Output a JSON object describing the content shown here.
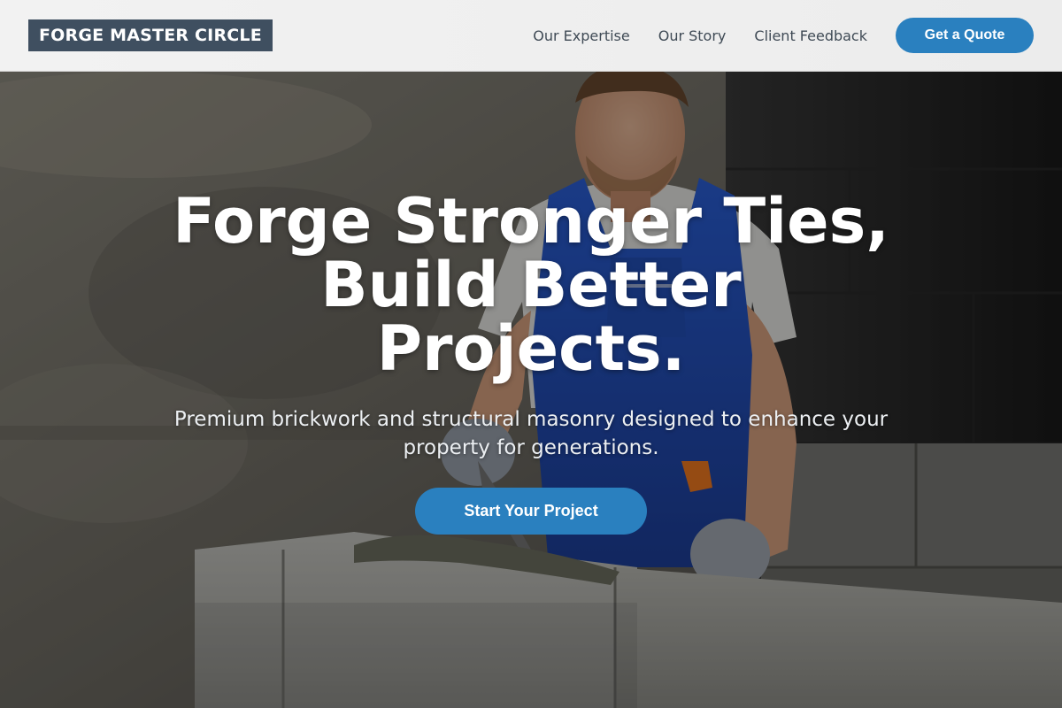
{
  "header": {
    "logo": "FORGE MASTER CIRCLE",
    "nav": [
      {
        "label": "Our Expertise"
      },
      {
        "label": "Our Story"
      },
      {
        "label": "Client Feedback"
      }
    ],
    "cta_label": "Get a Quote"
  },
  "hero": {
    "title_line1": "Forge Stronger Ties,",
    "title_line2": "Build Better",
    "title_line3": "Projects.",
    "subtitle": "Premium brickwork and structural masonry designed to enhance your property for generations.",
    "cta_label": "Start Your Project",
    "image_description": "mason in blue overalls laying concrete blocks"
  },
  "colors": {
    "accent": "#2a80bf",
    "logo_bg": "#3f4f60",
    "header_bg": "#efefef",
    "nav_text": "#3f4a55"
  }
}
